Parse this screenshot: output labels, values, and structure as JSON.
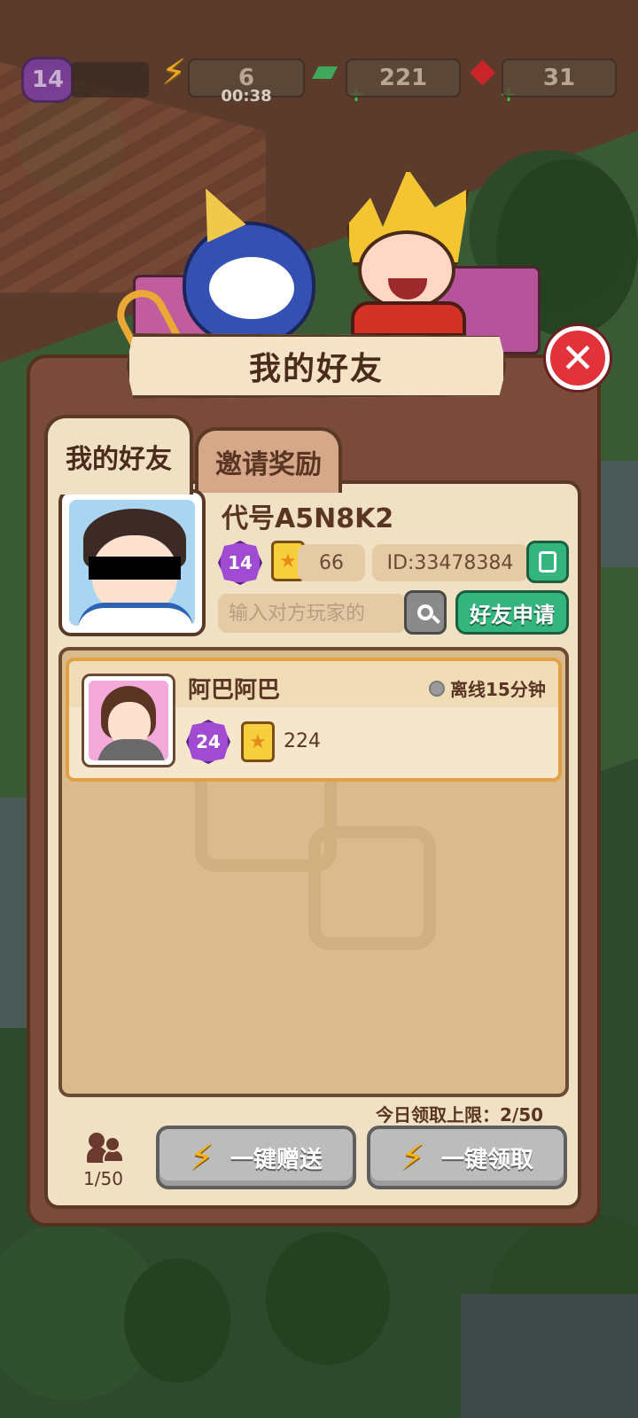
{
  "hud": {
    "player_level": "14",
    "energy": "6",
    "energy_timer": "00:38",
    "cash": "221",
    "gems": "31"
  },
  "dialog": {
    "title": "我的好友",
    "tabs": [
      {
        "label": "我的好友",
        "active": true
      },
      {
        "label": "邀请奖励",
        "active": false
      }
    ]
  },
  "profile": {
    "name": "代号A5N8K2",
    "level": "14",
    "stars": "66",
    "id_text": "ID:33478384"
  },
  "search": {
    "placeholder": "输入对方玩家的",
    "request_button": "好友申请"
  },
  "friends": [
    {
      "name": "阿巴阿巴",
      "status": "离线15分钟",
      "level": "24",
      "stars": "224"
    }
  ],
  "footer": {
    "daily_limit": "今日领取上限：2/50",
    "friend_count": "1/50",
    "send_all": "一键赠送",
    "claim_all": "一键领取"
  },
  "colors": {
    "accent_green": "#35b57e",
    "close_red": "#e2333a",
    "panel_bg": "#f1e1c4",
    "frame_brown": "#7a4b3a"
  }
}
